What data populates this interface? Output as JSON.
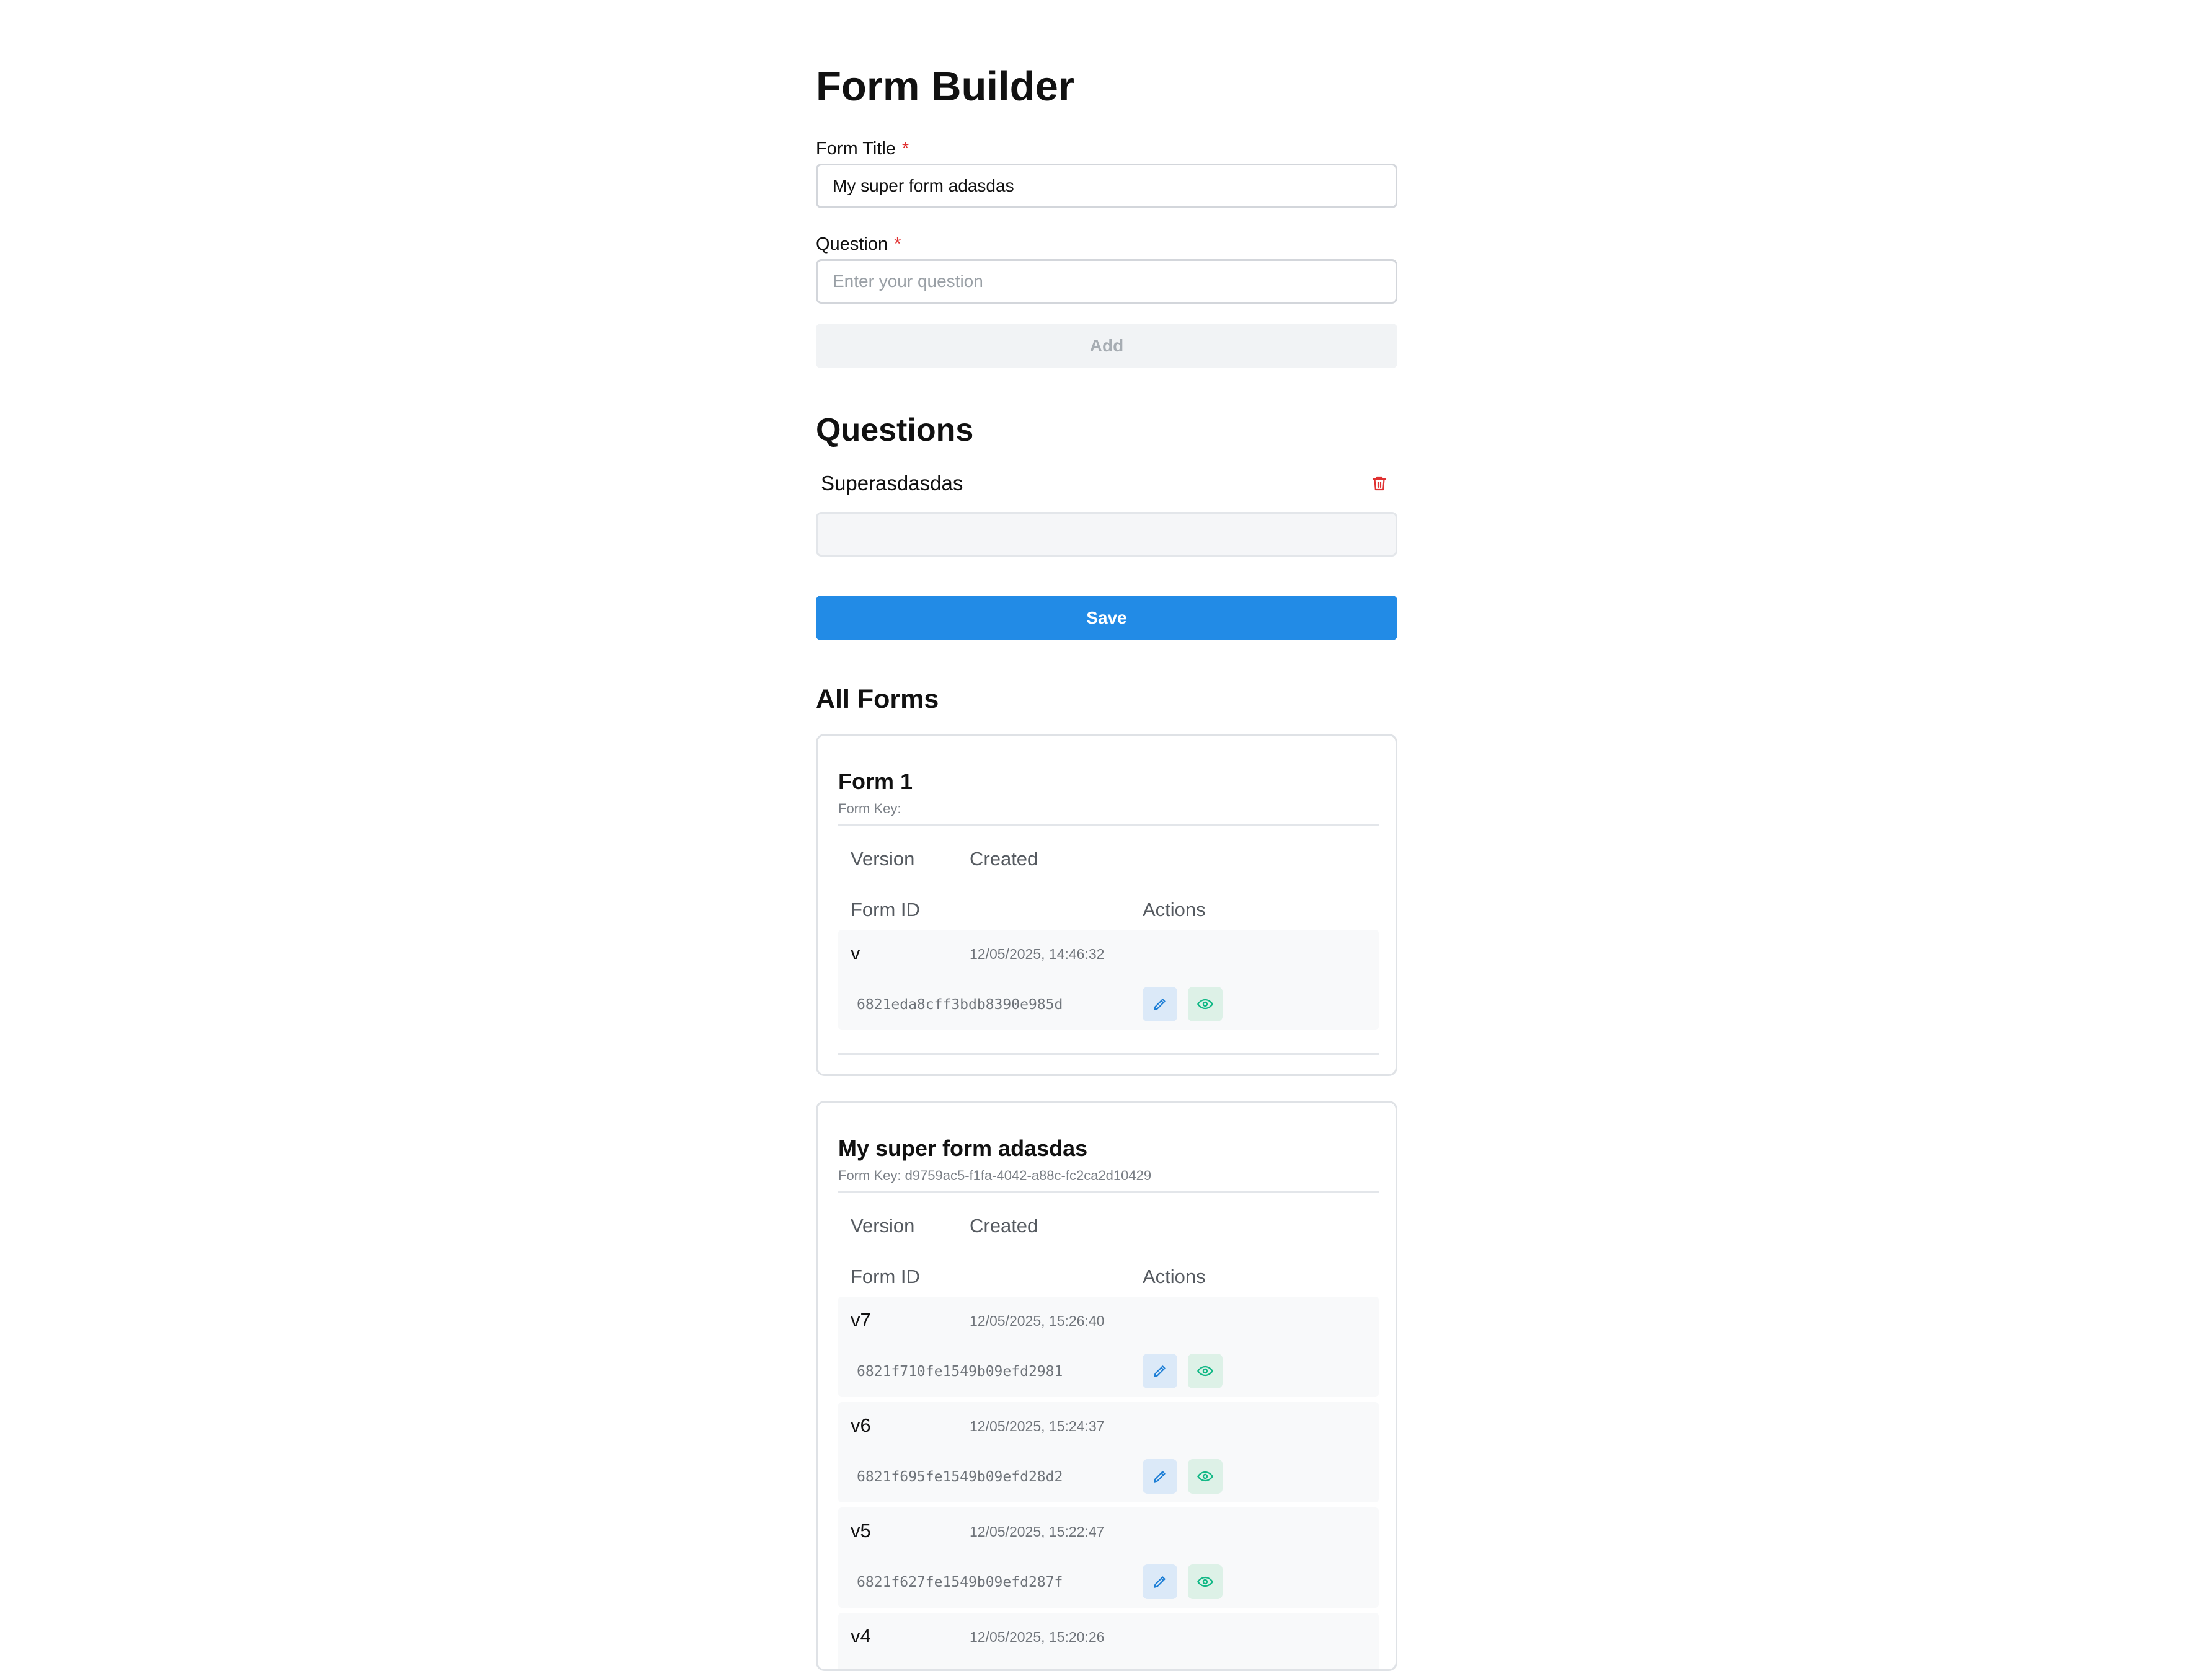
{
  "header": {
    "title": "Form Builder"
  },
  "form_title": {
    "label": "Form Title",
    "required_mark": "*",
    "value": "My super form adasdas"
  },
  "question": {
    "label": "Question",
    "required_mark": "*",
    "placeholder": "Enter your question",
    "value": ""
  },
  "add_button": {
    "label": "Add"
  },
  "questions_section": {
    "title": "Questions",
    "items": [
      {
        "text": "Superasdasdas",
        "answer_value": ""
      }
    ]
  },
  "save_button": {
    "label": "Save"
  },
  "all_forms": {
    "title": "All Forms",
    "columns": {
      "version": "Version",
      "created": "Created",
      "form_id": "Form ID",
      "actions": "Actions"
    },
    "forms": [
      {
        "title": "Form 1",
        "key_text": "Form Key:",
        "versions": [
          {
            "version": "v",
            "created": "12/05/2025, 14:46:32",
            "form_id": "6821eda8cff3bdb8390e985d"
          }
        ]
      },
      {
        "title": "My super form adasdas",
        "key_text": "Form Key: d9759ac5-f1fa-4042-a88c-fc2ca2d10429",
        "versions": [
          {
            "version": "v7",
            "created": "12/05/2025, 15:26:40",
            "form_id": "6821f710fe1549b09efd2981"
          },
          {
            "version": "v6",
            "created": "12/05/2025, 15:24:37",
            "form_id": "6821f695fe1549b09efd28d2"
          },
          {
            "version": "v5",
            "created": "12/05/2025, 15:22:47",
            "form_id": "6821f627fe1549b09efd287f"
          },
          {
            "version": "v4",
            "created": "12/05/2025, 15:20:26",
            "form_id": ""
          }
        ]
      }
    ]
  },
  "icons": {
    "delete": "trash-icon",
    "edit": "pencil-icon",
    "view": "eye-icon"
  },
  "colors": {
    "primary": "#228be6",
    "danger": "#e03131",
    "edit_icon": "#1c7ed6",
    "view_icon": "#12b886"
  }
}
